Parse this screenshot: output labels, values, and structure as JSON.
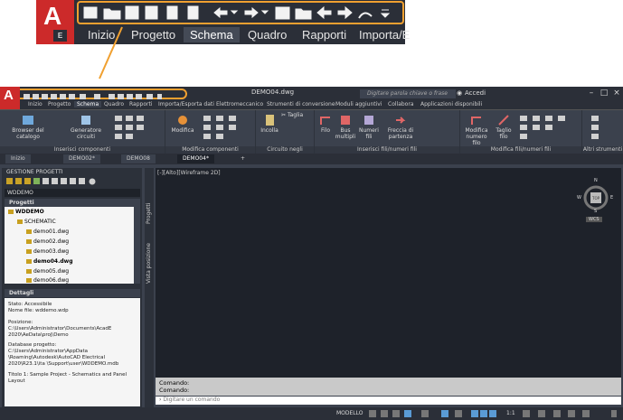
{
  "zoom_callout": {
    "logo_letter": "A",
    "logo_badge": "E",
    "qat_icons": [
      "new-icon",
      "open-icon",
      "save-icon",
      "saveas-icon",
      "plot-preview-icon",
      "publish-icon",
      "undo-icon",
      "undo-arrow-icon",
      "redo-icon",
      "redo-arrow-icon",
      "print-icon",
      "project-folder-icon",
      "back-icon",
      "forward-icon",
      "electrical-icon",
      "more-icon"
    ],
    "tabs": [
      "Inizio",
      "Progetto",
      "Schema",
      "Quadro",
      "Rapporti",
      "Importa/E"
    ],
    "active_tab": "Schema"
  },
  "titlebar": {
    "logo_letter": "A",
    "document": "DEMO04.dwg",
    "search_placeholder": "Digitare parola chiave o frase",
    "login": "Accedi"
  },
  "ribbon_tabs": [
    "Inizio",
    "Progetto",
    "Schema",
    "Quadro",
    "Rapporti",
    "Importa/Esporta dati",
    "Elettromeccanico",
    "Strumenti di conversione",
    "Moduli aggiuntivi",
    "Collabora",
    "Applicazioni disponibili"
  ],
  "ribbon": {
    "browser": "Browser del catalogo",
    "generator": "Generatore circuiti",
    "panel_insert": "Inserisci componenti",
    "modifica": "Modifica",
    "panel_modify": "Modifica componenti",
    "incolla": "Incolla",
    "taglia": "Taglia",
    "panel_clip": "Circuito negli Appunti",
    "filo": "Filo",
    "bus": "Bus multipli",
    "numeri": "Numeri fili",
    "freccia": "Freccia di partenza",
    "panel_wires": "Inserisci fili/numeri fili",
    "mod_numero": "Modifica numero filo",
    "taglia_filo": "Taglio filo",
    "panel_mod_wires": "Modifica fili/numeri fili",
    "panel_other": "Altri strumenti"
  },
  "doc_tabs": [
    "Inizio",
    "DEMO02*",
    "DEMO08",
    "DEMO04*"
  ],
  "active_doc": "DEMO04*",
  "project_manager": {
    "title": "GESTIONE PROGETTI",
    "current": "WDDEMO",
    "projects_label": "Progetti",
    "root": "WDDEMO",
    "folder": "SCHEMATIC",
    "files": [
      "demo01.dwg",
      "demo02.dwg",
      "demo03.dwg",
      "demo04.dwg",
      "demo05.dwg",
      "demo06.dwg"
    ],
    "active_file": "demo04.dwg",
    "side_tabs": [
      "Progetti",
      "Vista posizione"
    ]
  },
  "details": {
    "title": "Dettagli",
    "lines": [
      "Stato: Accessibile",
      "Nome file: wddemo.wdp",
      "",
      "Posizione: C:\\Users\\Administrator\\Documents\\AcadE 2020\\AeData\\proj\\Demo",
      "",
      "Database progetto: C:\\Users\\Administrator\\AppData \\Roaming\\Autodesk\\AutoCAD Electrical 2020\\R23.1\\ita \\Support\\user\\WDDEMO.mdb",
      "",
      "Titolo 1: Sample Project - Schematics and Panel Layout"
    ]
  },
  "drawing": {
    "viewport_label": "[-][Alto][Wireframe 2D]",
    "compass": {
      "n": "N",
      "s": "S",
      "e": "E",
      "w": "W",
      "top": "TOP"
    },
    "wcs": "WCS"
  },
  "command": {
    "history": [
      "Comando:",
      "Comando:"
    ],
    "placeholder": "Digitare un comando"
  },
  "statusbar": {
    "model": "MODELLO",
    "scale": "1:1"
  },
  "colors": {
    "accent": "#f0a030",
    "logo": "#cc2a2a",
    "ui_dark": "#2b2f38",
    "ui": "#3b414d"
  }
}
